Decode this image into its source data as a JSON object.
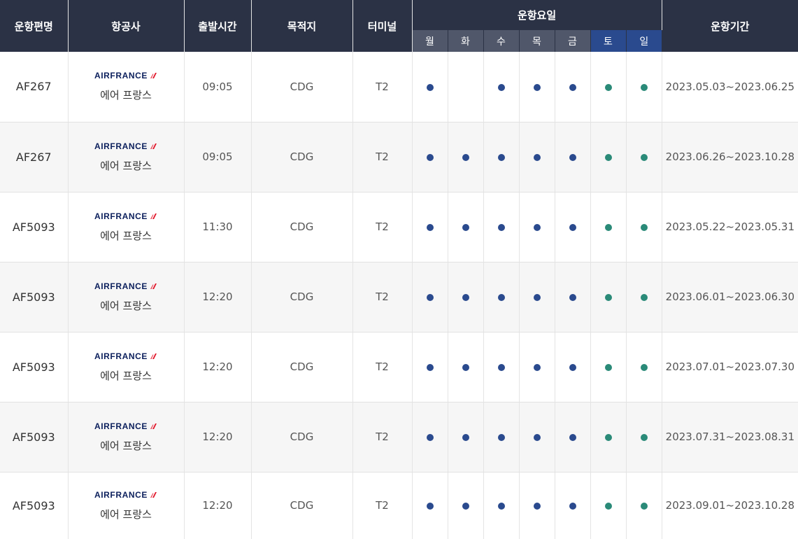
{
  "colors": {
    "header_bg": "#2b3245",
    "weekday_header_bg": "#50576a",
    "weekend_header_bg": "#2a4a8e",
    "weekday_dot": "#2a4a8e",
    "weekend_dot": "#2a8a78",
    "logo_text": "#0b1f5c",
    "logo_stripe": "#e2162a"
  },
  "header": {
    "flight_no": "운항편명",
    "airline": "항공사",
    "departure": "출발시간",
    "destination": "목적지",
    "terminal": "터미널",
    "days_group": "운항요일",
    "period": "운항기간",
    "days": [
      "월",
      "화",
      "수",
      "목",
      "금",
      "토",
      "일"
    ]
  },
  "rows": [
    {
      "flight_no": "AF267",
      "logo_text": "AIRFRANCE",
      "airline_name": "에어 프랑스",
      "departure": "09:05",
      "destination": "CDG",
      "terminal": "T2",
      "days": [
        true,
        false,
        true,
        true,
        true,
        true,
        true
      ],
      "period": "2023.05.03~2023.06.25"
    },
    {
      "flight_no": "AF267",
      "logo_text": "AIRFRANCE",
      "airline_name": "에어 프랑스",
      "departure": "09:05",
      "destination": "CDG",
      "terminal": "T2",
      "days": [
        true,
        true,
        true,
        true,
        true,
        true,
        true
      ],
      "period": "2023.06.26~2023.10.28"
    },
    {
      "flight_no": "AF5093",
      "logo_text": "AIRFRANCE",
      "airline_name": "에어 프랑스",
      "departure": "11:30",
      "destination": "CDG",
      "terminal": "T2",
      "days": [
        true,
        true,
        true,
        true,
        true,
        true,
        true
      ],
      "period": "2023.05.22~2023.05.31"
    },
    {
      "flight_no": "AF5093",
      "logo_text": "AIRFRANCE",
      "airline_name": "에어 프랑스",
      "departure": "12:20",
      "destination": "CDG",
      "terminal": "T2",
      "days": [
        true,
        true,
        true,
        true,
        true,
        true,
        true
      ],
      "period": "2023.06.01~2023.06.30"
    },
    {
      "flight_no": "AF5093",
      "logo_text": "AIRFRANCE",
      "airline_name": "에어 프랑스",
      "departure": "12:20",
      "destination": "CDG",
      "terminal": "T2",
      "days": [
        true,
        true,
        true,
        true,
        true,
        true,
        true
      ],
      "period": "2023.07.01~2023.07.30"
    },
    {
      "flight_no": "AF5093",
      "logo_text": "AIRFRANCE",
      "airline_name": "에어 프랑스",
      "departure": "12:20",
      "destination": "CDG",
      "terminal": "T2",
      "days": [
        true,
        true,
        true,
        true,
        true,
        true,
        true
      ],
      "period": "2023.07.31~2023.08.31"
    },
    {
      "flight_no": "AF5093",
      "logo_text": "AIRFRANCE",
      "airline_name": "에어 프랑스",
      "departure": "12:20",
      "destination": "CDG",
      "terminal": "T2",
      "days": [
        true,
        true,
        true,
        true,
        true,
        true,
        true
      ],
      "period": "2023.09.01~2023.10.28"
    }
  ]
}
